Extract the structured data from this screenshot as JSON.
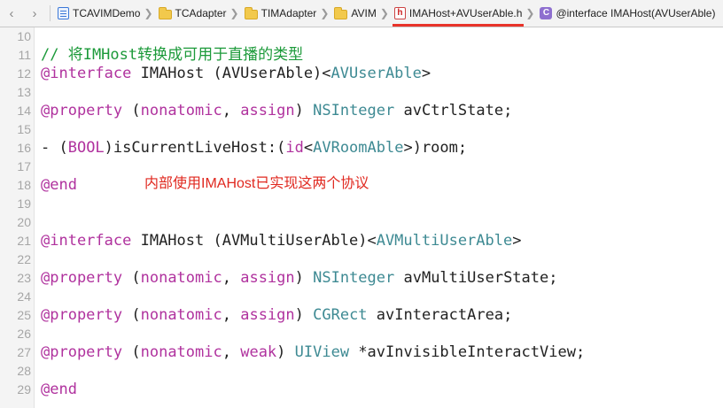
{
  "jumpbar": {
    "back_icon": "chevron-left",
    "forward_icon": "chevron-right",
    "crumbs": [
      {
        "label": "TCAVIMDemo",
        "icon": "project-icon"
      },
      {
        "label": "TCAdapter",
        "icon": "folder-icon"
      },
      {
        "label": "TIMAdapter",
        "icon": "folder-icon"
      },
      {
        "label": "AVIM",
        "icon": "folder-icon"
      },
      {
        "label": "IMAHost+AVUserAble.h",
        "icon": "header-file-icon"
      },
      {
        "label": "@interface IMAHost(AVUserAble)",
        "icon": "class-icon"
      }
    ],
    "h_glyph": "h",
    "c_glyph": "C"
  },
  "editor": {
    "line_numbers": [
      "10",
      "11",
      "12",
      "13",
      "14",
      "15",
      "16",
      "17",
      "18",
      "19",
      "20",
      "21",
      "22",
      "23",
      "24",
      "25",
      "26",
      "27",
      "28",
      "29"
    ],
    "lines": {
      "l11": {
        "comment": "// 将IMHost转换成可用于直播的类型"
      },
      "l12": {
        "kw": "@interface",
        "t1": " IMAHost (AVUserAble)<",
        "ty": "AVUserAble",
        "t2": ">"
      },
      "l14": {
        "kw": "@property",
        "t1": " (",
        "k1": "nonatomic",
        "t2": ", ",
        "k2": "assign",
        "t3": ") ",
        "ty": "NSInteger",
        "t4": " avCtrlState;"
      },
      "l16": {
        "t1": "- (",
        "k1": "BOOL",
        "t2": ")isCurrentLiveHost:(",
        "k2": "id",
        "t3": "<",
        "ty": "AVRoomAble",
        "t4": ">)room;"
      },
      "l18": {
        "kw": "@end"
      },
      "l21": {
        "kw": "@interface",
        "t1": " IMAHost (AVMultiUserAble)<",
        "ty": "AVMultiUserAble",
        "t2": ">"
      },
      "l23": {
        "kw": "@property",
        "t1": " (",
        "k1": "nonatomic",
        "t2": ", ",
        "k2": "assign",
        "t3": ") ",
        "ty": "NSInteger",
        "t4": " avMultiUserState;"
      },
      "l25": {
        "kw": "@property",
        "t1": " (",
        "k1": "nonatomic",
        "t2": ", ",
        "k2": "assign",
        "t3": ") ",
        "ty": "CGRect",
        "t4": " avInteractArea;"
      },
      "l27": {
        "kw": "@property",
        "t1": " (",
        "k1": "nonatomic",
        "t2": ", ",
        "k2": "weak",
        "t3": ") ",
        "ty": "UIView",
        "t4": " *avInvisibleInteractView;"
      },
      "l29": {
        "kw": "@end"
      }
    }
  },
  "annotation": {
    "text": "内部使用IMAHost已实现这两个协议",
    "color": "#e0281f"
  },
  "colors": {
    "keyword": "#b0329e",
    "type": "#3e8a93",
    "comment": "#1c9a3a",
    "highlight_underline": "#e8332a"
  }
}
